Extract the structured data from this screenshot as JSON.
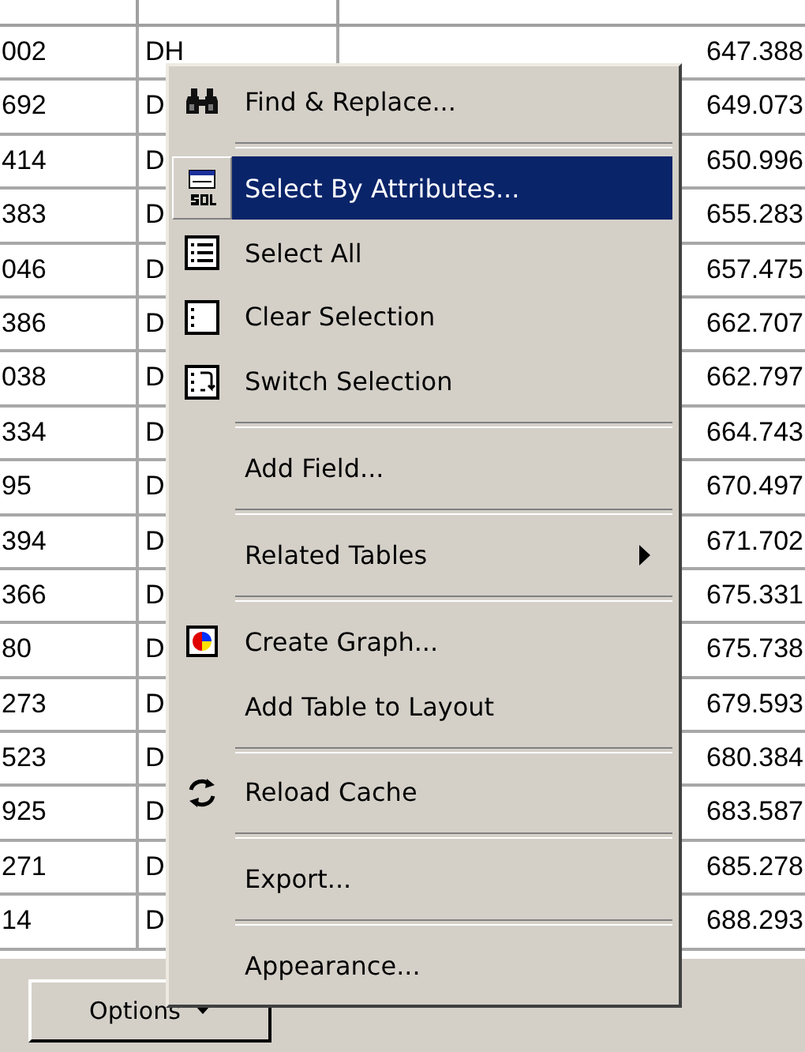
{
  "table": {
    "rows": [
      {
        "column_1": "002",
        "column_2": "DH",
        "column_3": "647.388"
      },
      {
        "column_1": "692",
        "column_2": "D",
        "column_3": "649.073"
      },
      {
        "column_1": "414",
        "column_2": "D",
        "column_3": "650.996"
      },
      {
        "column_1": "383",
        "column_2": "D",
        "column_3": "655.283"
      },
      {
        "column_1": "046",
        "column_2": "D",
        "column_3": "657.475"
      },
      {
        "column_1": "386",
        "column_2": "D",
        "column_3": "662.707"
      },
      {
        "column_1": "038",
        "column_2": "D",
        "column_3": "662.797"
      },
      {
        "column_1": "334",
        "column_2": "D",
        "column_3": "664.743"
      },
      {
        "column_1": "95",
        "column_2": "D",
        "column_3": "670.497"
      },
      {
        "column_1": "394",
        "column_2": "D",
        "column_3": "671.702"
      },
      {
        "column_1": "366",
        "column_2": "D",
        "column_3": "675.331"
      },
      {
        "column_1": "80",
        "column_2": "D",
        "column_3": "675.738"
      },
      {
        "column_1": "273",
        "column_2": "D",
        "column_3": "679.593"
      },
      {
        "column_1": "523",
        "column_2": "D",
        "column_3": "680.384"
      },
      {
        "column_1": "925",
        "column_2": "D",
        "column_3": "683.587"
      },
      {
        "column_1": "271",
        "column_2": "D",
        "column_3": "685.278"
      },
      {
        "column_1": "14",
        "column_2": "D",
        "column_3": "688.293"
      }
    ]
  },
  "options_button": {
    "label": "Options"
  },
  "menu": {
    "items": [
      {
        "kind": "item",
        "label": "Find & Replace...",
        "selected": false,
        "submenu": false
      },
      {
        "kind": "separator"
      },
      {
        "kind": "item",
        "label": "Select By Attributes...",
        "selected": true,
        "submenu": false
      },
      {
        "kind": "item",
        "label": "Select All",
        "selected": false,
        "submenu": false
      },
      {
        "kind": "item",
        "label": "Clear Selection",
        "selected": false,
        "submenu": false
      },
      {
        "kind": "item",
        "label": "Switch Selection",
        "selected": false,
        "submenu": false
      },
      {
        "kind": "separator"
      },
      {
        "kind": "item",
        "label": "Add Field...",
        "selected": false,
        "submenu": false
      },
      {
        "kind": "separator"
      },
      {
        "kind": "item",
        "label": "Related Tables",
        "selected": false,
        "submenu": true
      },
      {
        "kind": "separator"
      },
      {
        "kind": "item",
        "label": "Create Graph...",
        "selected": false,
        "submenu": false
      },
      {
        "kind": "item",
        "label": "Add Table to Layout",
        "selected": false,
        "submenu": false
      },
      {
        "kind": "separator"
      },
      {
        "kind": "item",
        "label": "Reload Cache",
        "selected": false,
        "submenu": false
      },
      {
        "kind": "separator"
      },
      {
        "kind": "item",
        "label": "Export...",
        "selected": false,
        "submenu": false
      },
      {
        "kind": "separator"
      },
      {
        "kind": "item",
        "label": "Appearance...",
        "selected": false,
        "submenu": false
      }
    ]
  }
}
